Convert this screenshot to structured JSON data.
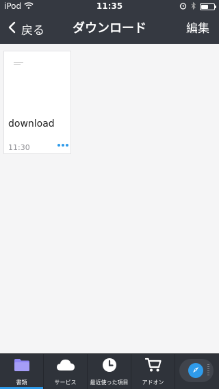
{
  "status_bar": {
    "carrier": "iPod",
    "time": "11:35",
    "battery_level": 0.55
  },
  "nav": {
    "back_label": "戻る",
    "title": "ダウンロード",
    "edit_label": "編集"
  },
  "documents": [
    {
      "name": "download",
      "time": "11:30"
    }
  ],
  "tabs": [
    {
      "label": "書類",
      "icon": "folder-icon",
      "active": true
    },
    {
      "label": "サービス",
      "icon": "cloud-icon",
      "active": false
    },
    {
      "label": "最近使った項目",
      "icon": "clock-icon",
      "active": false
    },
    {
      "label": "アドオン",
      "icon": "cart-icon",
      "active": false
    }
  ],
  "browser_button": {
    "icon": "compass-icon"
  },
  "colors": {
    "header": "#353941",
    "accent": "#2f9bea",
    "folder": "#8f86f4",
    "background": "#f5f5f6"
  }
}
